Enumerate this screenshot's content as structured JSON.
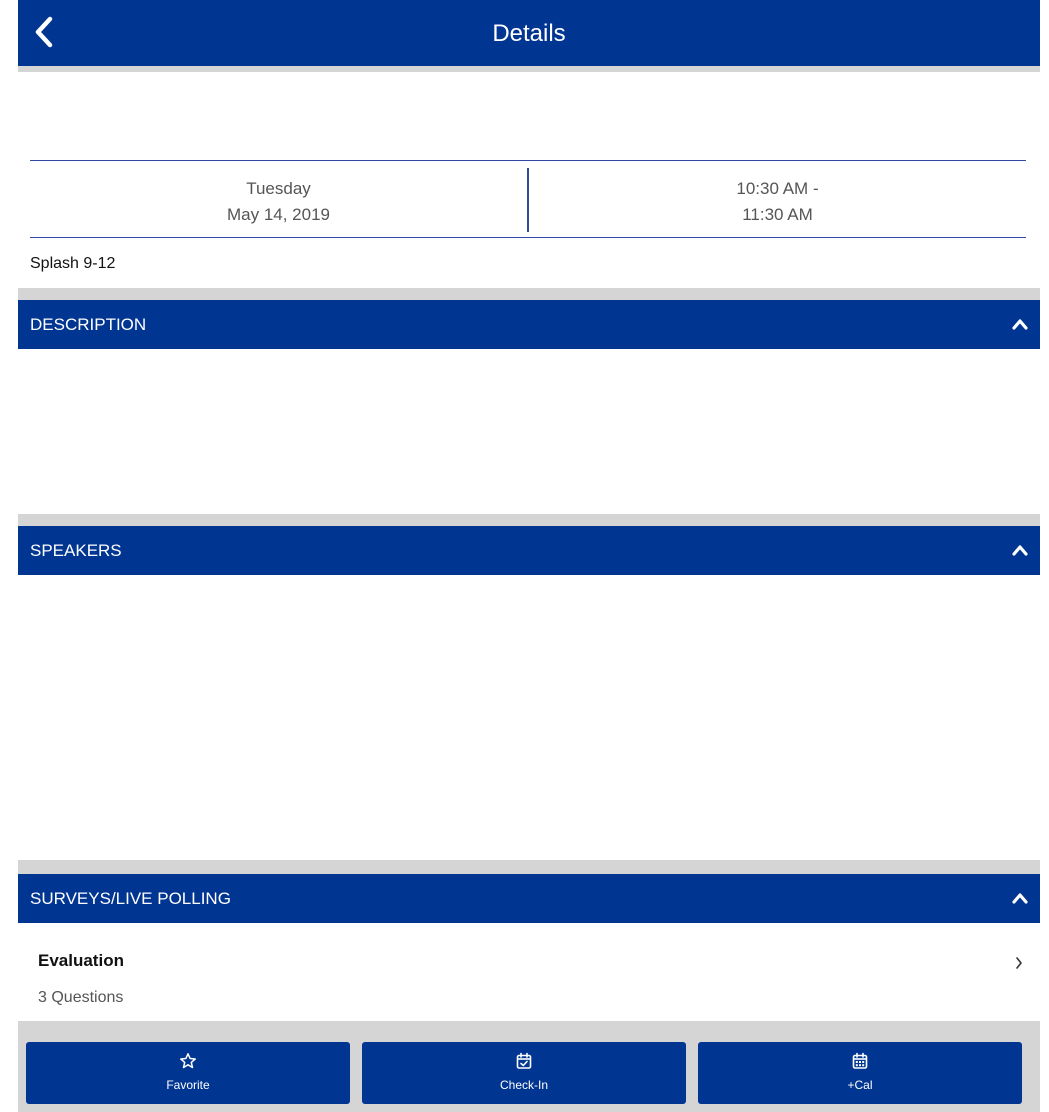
{
  "header": {
    "title": "Details",
    "back_icon": "chevron-left-icon"
  },
  "session": {
    "day": "Tuesday",
    "date": "May 14, 2019",
    "time_start": "10:30 AM -",
    "time_end": "11:30 AM",
    "location": "Splash 9-12"
  },
  "sections": {
    "description": {
      "title": "DESCRIPTION",
      "icon": "chevron-up-icon"
    },
    "speakers": {
      "title": "SPEAKERS",
      "icon": "chevron-up-icon"
    },
    "surveys": {
      "title": "SURVEYS/LIVE POLLING",
      "icon": "chevron-up-icon"
    }
  },
  "survey_item": {
    "title": "Evaluation",
    "subtitle": "3 Questions",
    "icon": "chevron-right-icon"
  },
  "actions": [
    {
      "label": "Favorite",
      "icon": "star-outline-icon"
    },
    {
      "label": "Check-In",
      "icon": "calendar-check-icon"
    },
    {
      "label": "+Cal",
      "icon": "calendar-icon"
    }
  ],
  "colors": {
    "primary": "#003591",
    "background": "#d5d5d5",
    "card": "#ffffff",
    "divider": "#2f4aa0"
  }
}
